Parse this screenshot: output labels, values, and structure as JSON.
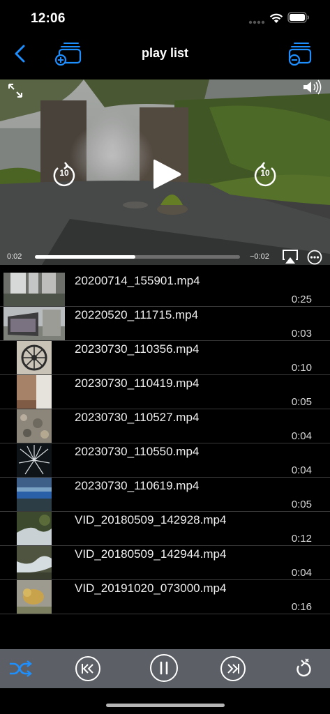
{
  "status_bar": {
    "time": "12:06"
  },
  "nav": {
    "title": "play list"
  },
  "player": {
    "current_time": "0:02",
    "remaining_time": "−0:02",
    "progress": 0.49,
    "skip_back_seconds": "10",
    "skip_forward_seconds": "10"
  },
  "playlist": [
    {
      "name": "20200714_155901.mp4",
      "duration": "0:25",
      "thumb": "waterfall"
    },
    {
      "name": "20220520_111715.mp4",
      "duration": "0:03",
      "thumb": "building"
    },
    {
      "name": "20230730_110356.mp4",
      "duration": "0:10",
      "thumb": "clock"
    },
    {
      "name": "20230730_110419.mp4",
      "duration": "0:05",
      "thumb": "room"
    },
    {
      "name": "20230730_110527.mp4",
      "duration": "0:04",
      "thumb": "rocks"
    },
    {
      "name": "20230730_110550.mp4",
      "duration": "0:04",
      "thumb": "fireworks"
    },
    {
      "name": "20230730_110619.mp4",
      "duration": "0:05",
      "thumb": "pool"
    },
    {
      "name": "VID_20180509_142928.mp4",
      "duration": "0:12",
      "thumb": "stream"
    },
    {
      "name": "VID_20180509_142944.mp4",
      "duration": "0:04",
      "thumb": "stream2"
    },
    {
      "name": "VID_20191020_073000.mp4",
      "duration": "0:16",
      "thumb": "animal"
    }
  ],
  "colors": {
    "accent": "#1e8fff",
    "toolbar": "#5c6066",
    "background": "#000000"
  }
}
